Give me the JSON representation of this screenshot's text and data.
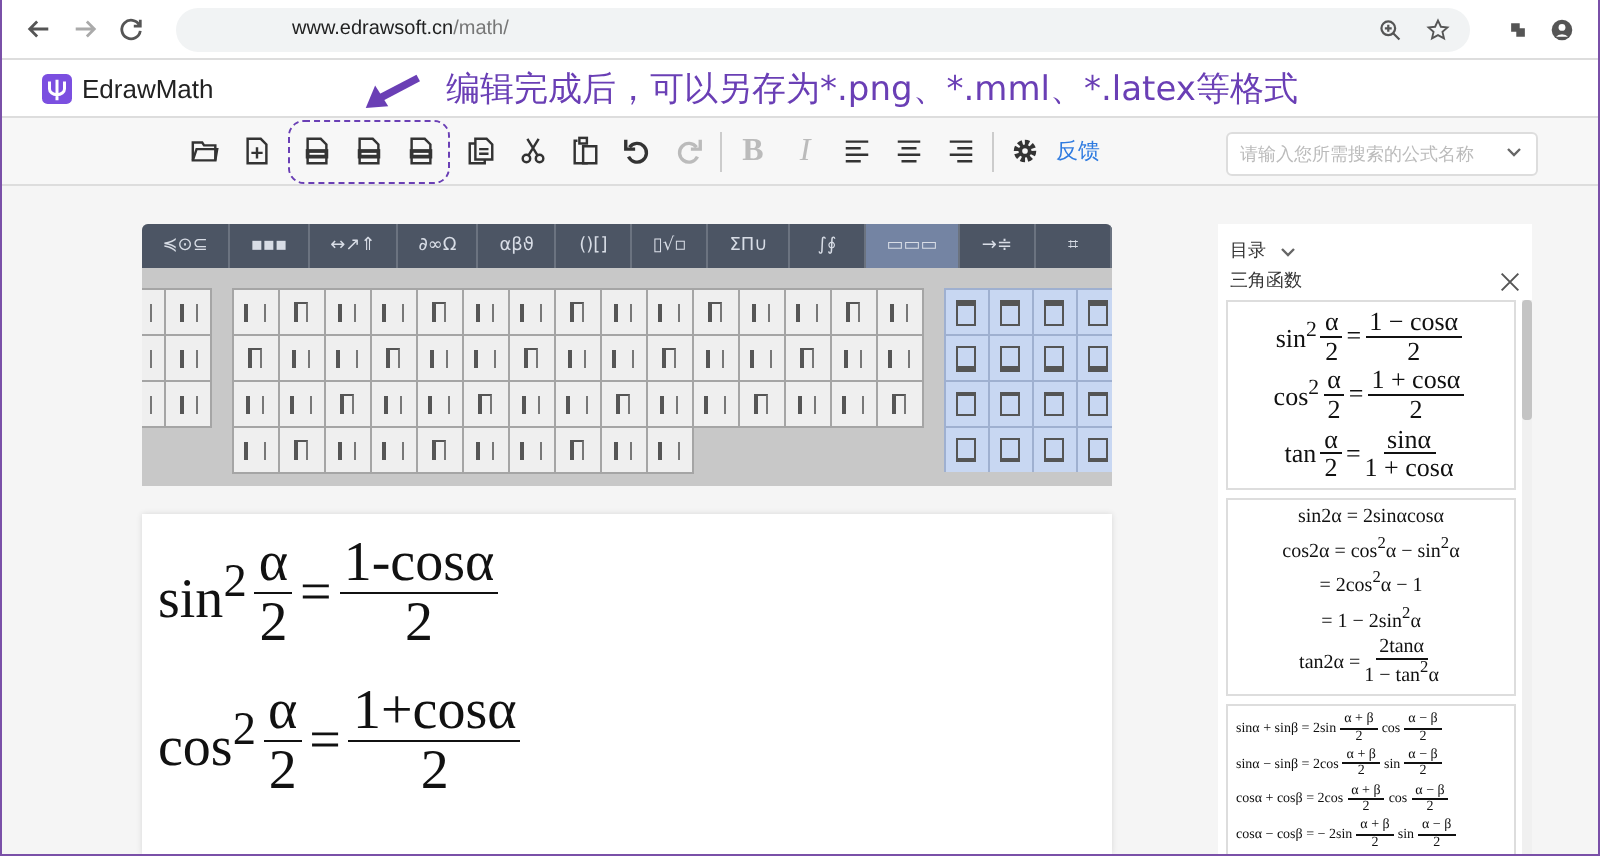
{
  "browser": {
    "url_host": "www.edrawsoft.cn",
    "url_path": "/math/"
  },
  "header": {
    "logo": "EdrawMath",
    "annotation": "编辑完成后，可以另存为*.png、*.mml、*.latex等格式"
  },
  "toolbar": {
    "groups": [
      {
        "kind": "group",
        "highlighted": false,
        "items": [
          {
            "kind": "open",
            "disabled": false
          },
          {
            "kind": "new",
            "disabled": false
          }
        ]
      },
      {
        "kind": "group",
        "highlighted": true,
        "items": [
          {
            "kind": "export",
            "disabled": false
          },
          {
            "kind": "export",
            "disabled": false
          },
          {
            "kind": "export",
            "disabled": false
          }
        ]
      },
      {
        "kind": "group",
        "highlighted": false,
        "items": [
          {
            "kind": "copy",
            "disabled": false
          },
          {
            "kind": "cut",
            "disabled": false
          },
          {
            "kind": "paste",
            "disabled": false
          },
          {
            "kind": "undo",
            "disabled": false
          },
          {
            "kind": "redo",
            "disabled": true
          }
        ]
      },
      {
        "kind": "divider"
      },
      {
        "kind": "group",
        "highlighted": false,
        "items": [
          {
            "kind": "letter",
            "label": "B",
            "disabled": true
          },
          {
            "kind": "letter",
            "label": "I",
            "disabled": true
          },
          {
            "kind": "align-left",
            "disabled": false
          },
          {
            "kind": "align-center",
            "disabled": false
          },
          {
            "kind": "align-right",
            "disabled": false
          }
        ]
      },
      {
        "kind": "divider"
      },
      {
        "kind": "group",
        "highlighted": false,
        "items": [
          {
            "kind": "settings",
            "disabled": false
          },
          {
            "kind": "link",
            "label": "反馈",
            "disabled": false
          }
        ]
      }
    ],
    "search": {
      "placeholder": "请输入您所需搜索的公式名称"
    }
  },
  "palette": {
    "tabs": [
      {
        "label": "≼⊙⊆",
        "selected": false
      },
      {
        "label": "▪▪▪",
        "selected": false
      },
      {
        "label": "↔↗⇑",
        "selected": false
      },
      {
        "label": "∂∞Ω",
        "selected": false
      },
      {
        "label": "αβϑ",
        "selected": false
      },
      {
        "label": "()[]",
        "selected": false
      },
      {
        "label": "▯√▫",
        "selected": false
      },
      {
        "label": "ΣΠ∪",
        "selected": false
      },
      {
        "label": "∫∮",
        "selected": false
      },
      {
        "label": "▭▭▭",
        "selected": true
      },
      {
        "label": "→≑",
        "selected": false
      },
      {
        "label": "⌗",
        "selected": false
      }
    ]
  },
  "editor": {
    "formulas": [
      [
        "sin$^{2}$",
        {
          "num": "α",
          "den": "2"
        },
        "=",
        {
          "num": "1-cosα",
          "den": "2"
        }
      ],
      [
        "cos$^{2}$",
        {
          "num": "α",
          "den": "2"
        },
        "=",
        {
          "num": "1+cosα",
          "den": "2"
        }
      ]
    ]
  },
  "library": {
    "menu": "目录",
    "category": "三角函数",
    "cards": [
      {
        "lines": [
          [
            "sin$^{2}$",
            {
              "num": "α",
              "den": "2"
            },
            " = ",
            {
              "num": "1 − cosα",
              "den": "2"
            }
          ],
          [
            "cos$^{2}$",
            {
              "num": "α",
              "den": "2"
            },
            " = ",
            {
              "num": "1 + cosα",
              "den": "2"
            }
          ],
          [
            "tan",
            {
              "num": "α",
              "den": "2"
            },
            " = ",
            {
              "num": "sinα",
              "den": "1 + cosα"
            }
          ]
        ]
      },
      {
        "lines": [
          [
            "sin2α = 2sinαcosα"
          ],
          [
            "cos2α = cos$^{2}$α − sin$^{2}$α"
          ],
          [
            "= 2cos$^{2}$α − 1"
          ],
          [
            "= 1 − 2sin$^{2}$α"
          ],
          [
            "tan2α = ",
            {
              "num": "2tanα",
              "den": "1 − tan$^{2}$α"
            }
          ]
        ]
      },
      {
        "lines": [
          [
            "sinα + sinβ = 2sin",
            {
              "num": "α + β",
              "den": "2"
            },
            "cos",
            {
              "num": "α − β",
              "den": "2"
            }
          ],
          [
            "sinα − sinβ = 2cos",
            {
              "num": "α + β",
              "den": "2"
            },
            "sin",
            {
              "num": "α − β",
              "den": "2"
            }
          ],
          [
            "cosα + cosβ = 2cos",
            {
              "num": "α + β",
              "den": "2"
            },
            "cos",
            {
              "num": "α − β",
              "den": "2"
            }
          ],
          [
            "cosα − cosβ = − 2sin",
            {
              "num": "α + β",
              "den": "2"
            },
            "sin",
            {
              "num": "α − β",
              "den": "2"
            }
          ]
        ]
      }
    ]
  }
}
